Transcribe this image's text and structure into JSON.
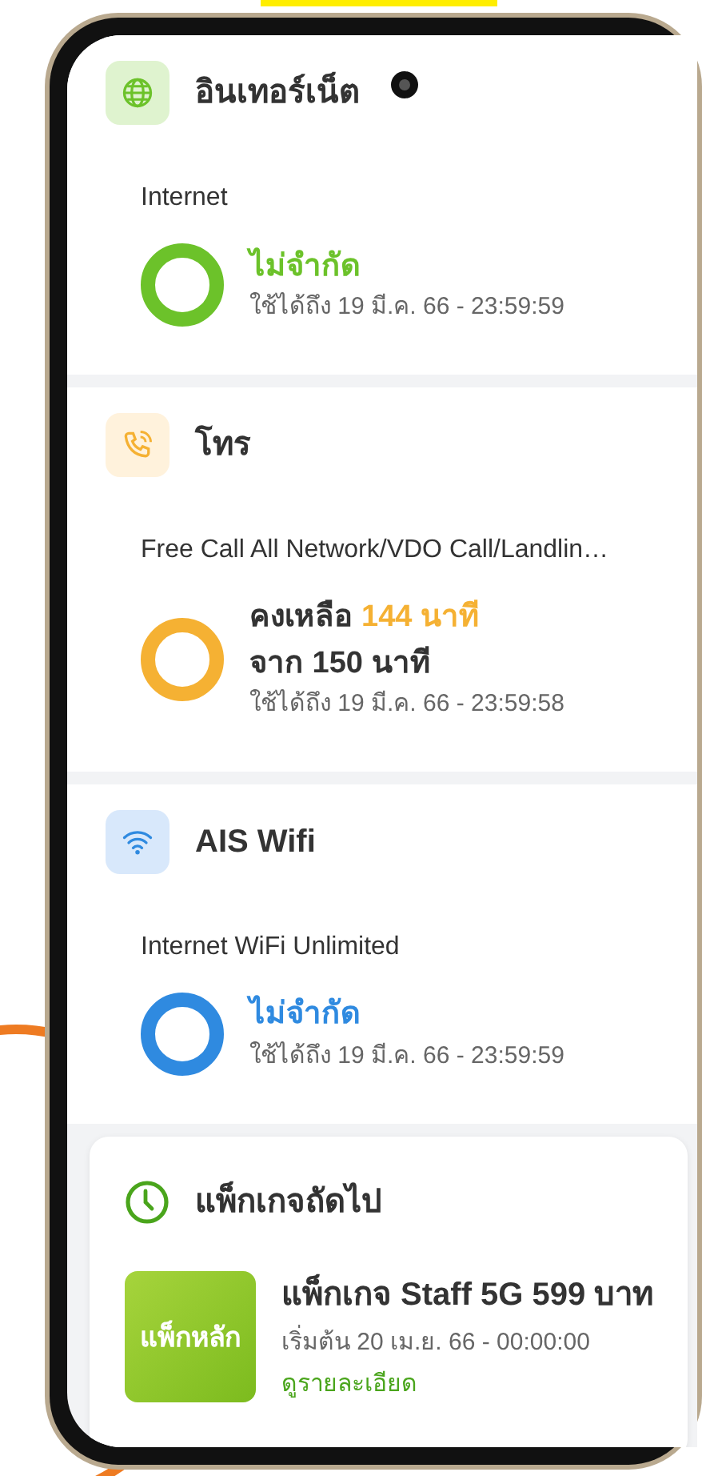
{
  "sections": [
    {
      "kind": "internet",
      "title": "อินเทอร์เน็ต",
      "subtitle": "Internet",
      "color": "#6cc22a",
      "value": [
        {
          "text": "ไม่จำกัด",
          "highlight": true
        }
      ],
      "expiry": "ใช้ได้ถึง 19 มี.ค. 66 - 23:59:59"
    },
    {
      "kind": "call",
      "title": "โทร",
      "subtitle": "Free Call All Network/VDO Call/Landlin…",
      "color": "#f5b133",
      "value": [
        {
          "text": "คงเหลือ",
          "highlight": false
        },
        {
          "text": "144 นาที",
          "highlight": true
        },
        {
          "text": "จาก 150 นาที",
          "highlight": false
        }
      ],
      "expiry": "ใช้ได้ถึง 19 มี.ค. 66 - 23:59:58"
    },
    {
      "kind": "wifi",
      "title": "AIS Wifi",
      "subtitle": "Internet WiFi Unlimited",
      "color": "#2f8ae0",
      "value": [
        {
          "text": "ไม่จำกัด",
          "highlight": true
        }
      ],
      "expiry": "ใช้ได้ถึง 19 มี.ค. 66 - 23:59:59"
    }
  ],
  "next_package": {
    "title": "แพ็กเกจถัดไป",
    "tile": "แพ็กหลัก",
    "name": "แพ็กเกจ Staff 5G 599 บาท",
    "start": "เริ่มต้น 20 เม.ย. 66 - 00:00:00",
    "link": "ดูรายละเอียด"
  }
}
